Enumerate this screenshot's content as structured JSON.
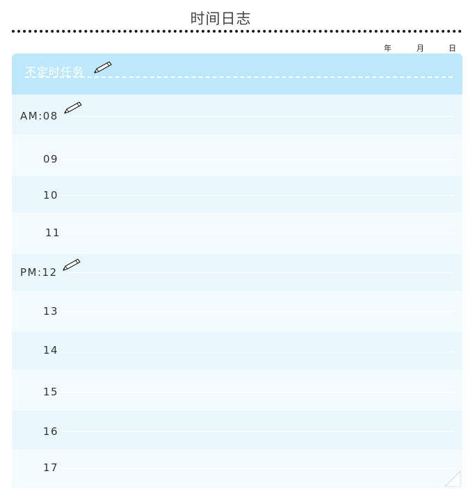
{
  "page": {
    "title": "时间日志",
    "date": {
      "year": "年",
      "month": "月",
      "day": "日"
    }
  },
  "header": {
    "label": "不定时任务",
    "icon": "pencil-icon"
  },
  "hours": [
    {
      "label": "AM:08",
      "icon": "pencil-icon"
    },
    {
      "label": "09"
    },
    {
      "label": "10"
    },
    {
      "label": "11"
    },
    {
      "label": "PM:12",
      "icon": "pencil-icon"
    },
    {
      "label": "13"
    },
    {
      "label": "14"
    },
    {
      "label": "15"
    },
    {
      "label": "16"
    },
    {
      "label": "17"
    }
  ],
  "colors": {
    "header_band": "#bde8f9",
    "row_tint": "#eaf7fd",
    "row_pale": "#f4fbfe"
  }
}
